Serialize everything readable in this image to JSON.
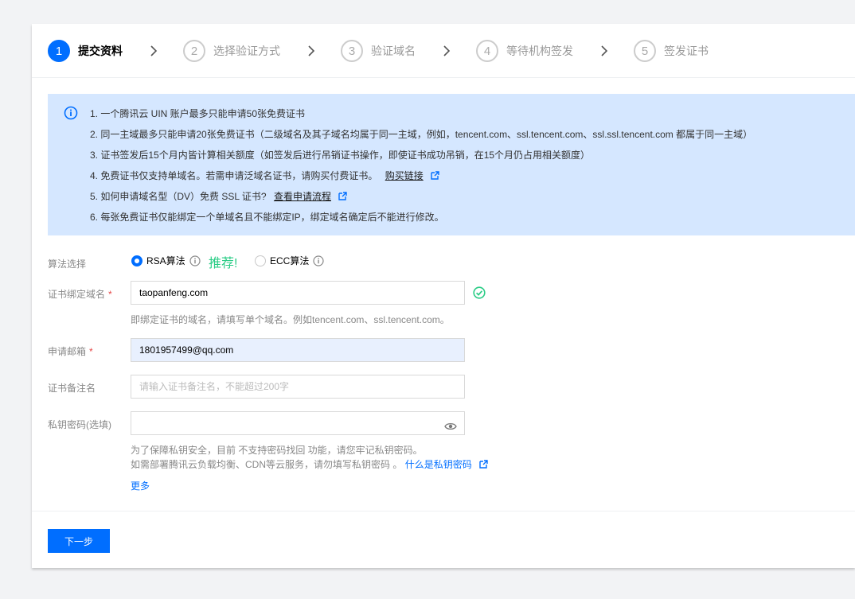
{
  "steps": [
    {
      "num": "1",
      "label": "提交资料"
    },
    {
      "num": "2",
      "label": "选择验证方式"
    },
    {
      "num": "3",
      "label": "验证域名"
    },
    {
      "num": "4",
      "label": "等待机构签发"
    },
    {
      "num": "5",
      "label": "签发证书"
    }
  ],
  "notice": {
    "line1": "1. 一个腾讯云 UIN 账户最多只能申请50张免费证书",
    "line2": "2. 同一主域最多只能申请20张免费证书（二级域名及其子域名均属于同一主域，例如，tencent.com、ssl.tencent.com、ssl.ssl.tencent.com 都属于同一主域）",
    "line3": "3. 证书签发后15个月内皆计算相关额度（如签发后进行吊销证书操作，即使证书成功吊销，在15个月仍占用相关额度）",
    "line4_text": "4. 免费证书仅支持单域名。若需申请泛域名证书，请购买付费证书。",
    "line4_link": "购买链接",
    "line5_text": "5. 如何申请域名型（DV）免费 SSL 证书?",
    "line5_link": "查看申请流程",
    "line6": "6. 每张免费证书仅能绑定一个单域名且不能绑定IP，绑定域名确定后不能进行修改。"
  },
  "form": {
    "algo_label": "算法选择",
    "rsa_label": "RSA算法",
    "recommend": "推荐!",
    "ecc_label": "ECC算法",
    "domain_label": "证书绑定域名",
    "domain_value": "taopanfeng.com",
    "domain_hint": "即绑定证书的域名，请填写单个域名。例如tencent.com、ssl.tencent.com。",
    "email_label": "申请邮箱",
    "email_value": "1801957499@qq.com",
    "remark_label": "证书备注名",
    "remark_placeholder": "请输入证书备注名，不能超过200字",
    "key_label": "私钥密码(选填)",
    "key_hint1": "为了保障私钥安全，目前 不支持密码找回 功能，请您牢记私钥密码。",
    "key_hint2": "如需部署腾讯云负载均衡、CDN等云服务，请勿填写私钥密码 。",
    "key_hint2_link": "什么是私钥密码",
    "more": "更多",
    "required_mark": "*"
  },
  "next_button": "下一步",
  "colors": {
    "primary": "#006eff",
    "notice_bg": "#d5e7ff",
    "success": "#29cc85",
    "required": "#e54545"
  }
}
